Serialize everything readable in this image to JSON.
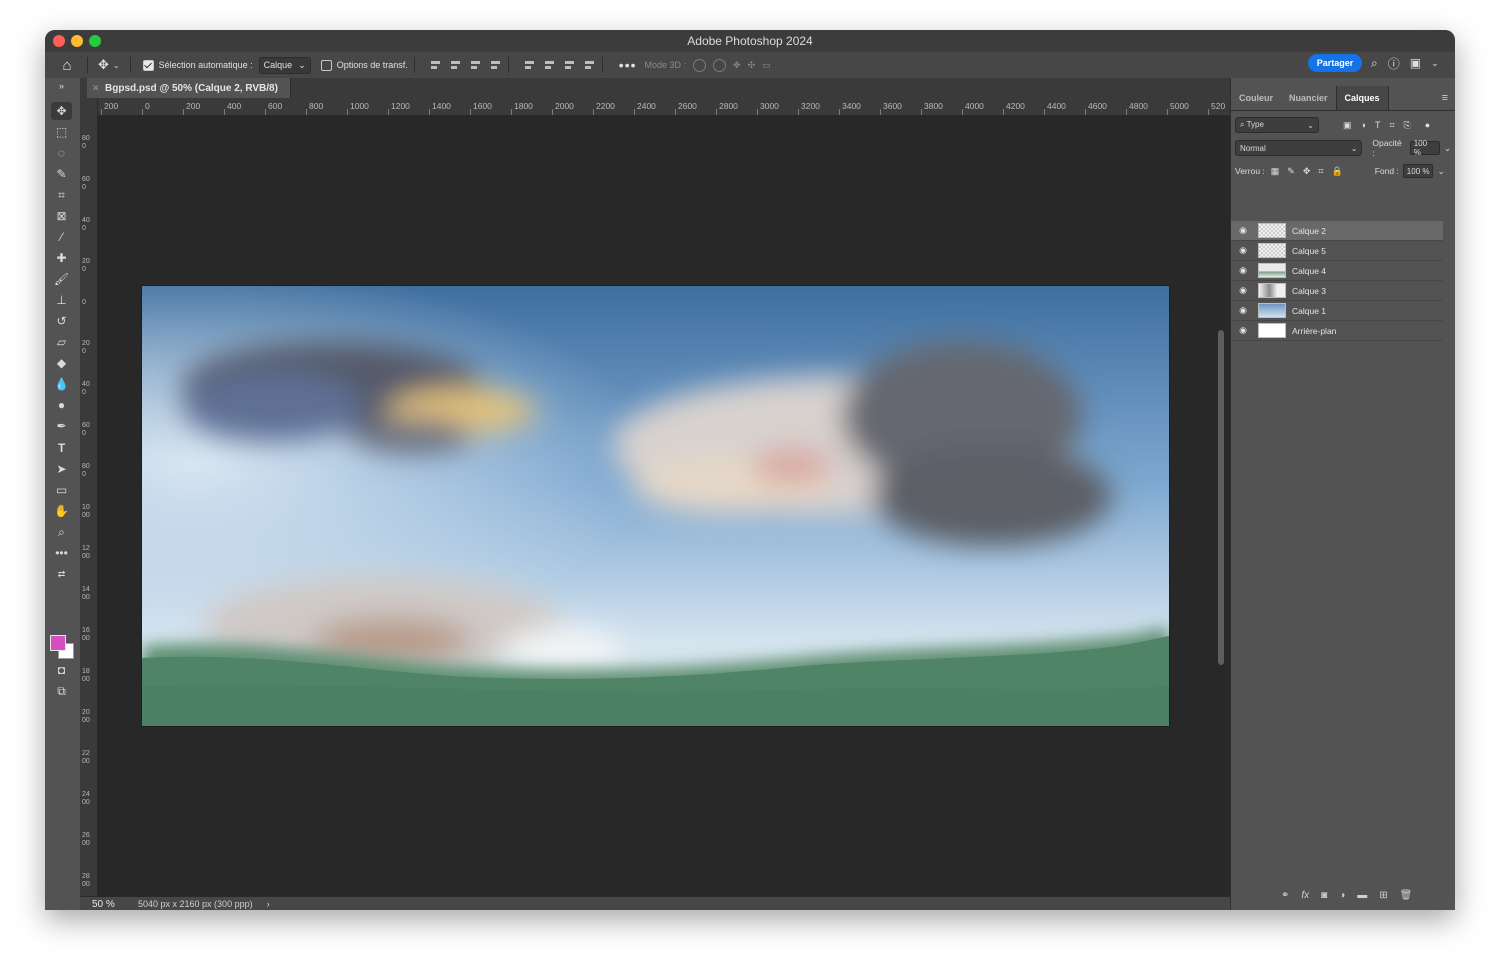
{
  "window": {
    "title": "Adobe Photoshop 2024"
  },
  "options_bar": {
    "auto_select_label": "Sélection automatique :",
    "auto_select_checked": true,
    "auto_select_target": "Calque",
    "transform_options_label": "Options de transf.",
    "transform_options_checked": false,
    "mode_3d_label": "Mode 3D :",
    "more_label": "•••",
    "share_label": "Partager"
  },
  "document": {
    "tab_title": "Bgpsd.psd @ 50% (Calque 2, RVB/8)",
    "zoom": "50 %",
    "info": "5040 px x 2160 px (300 ppp)"
  },
  "ruler": {
    "top_labels": [
      "200",
      "0",
      "200",
      "400",
      "600",
      "800",
      "1000",
      "1200",
      "1400",
      "1600",
      "1800",
      "2000",
      "2200",
      "2400",
      "2600",
      "2800",
      "3000",
      "3200",
      "3400",
      "3600",
      "3800",
      "4000",
      "4200",
      "4400",
      "4600",
      "4800",
      "5000",
      "520"
    ],
    "left_labels": [
      "800",
      "600",
      "400",
      "200",
      "0",
      "200",
      "400",
      "600",
      "800",
      "1000",
      "1200",
      "1400",
      "1600",
      "1800",
      "2000",
      "2200",
      "2400",
      "2600",
      "2800"
    ]
  },
  "panel": {
    "tabs": [
      "Couleur",
      "Nuancier",
      "Calques"
    ],
    "active_tab": "Calques",
    "filter_type": "Type",
    "blend_mode": "Normal",
    "opacity_label": "Opacité :",
    "opacity_value": "100 %",
    "lock_label": "Verrou :",
    "fill_label": "Fond :",
    "fill_value": "100 %",
    "layers": [
      {
        "name": "Calque 2",
        "selected": true,
        "thumb": "checker"
      },
      {
        "name": "Calque 5",
        "selected": false,
        "thumb": "checker"
      },
      {
        "name": "Calque 4",
        "selected": false,
        "thumb": "grass"
      },
      {
        "name": "Calque 3",
        "selected": false,
        "thumb": "cloud"
      },
      {
        "name": "Calque 1",
        "selected": false,
        "thumb": "sky"
      },
      {
        "name": "Arrière-plan",
        "selected": false,
        "thumb": "white"
      }
    ]
  },
  "colors": {
    "foreground": "#d64fc0",
    "background": "#ffffff",
    "accent": "#1473e6"
  }
}
